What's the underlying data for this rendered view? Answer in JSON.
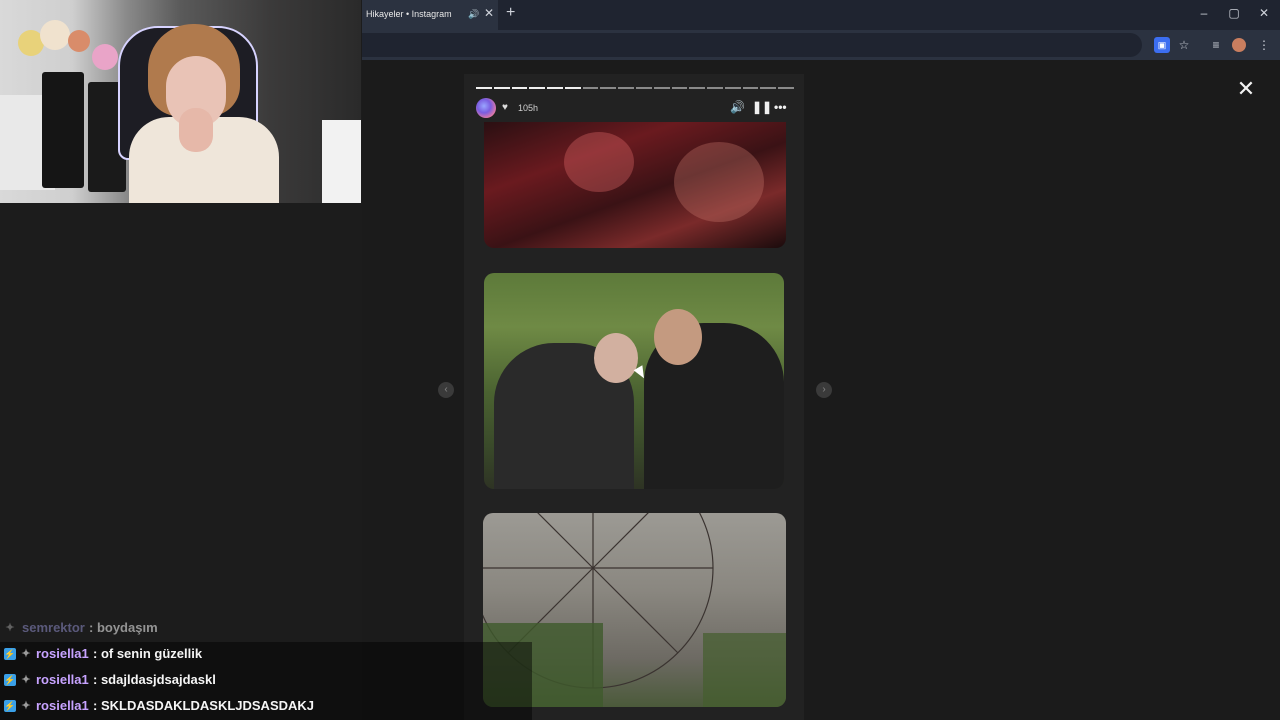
{
  "browser": {
    "tab_title": "Hikayeler • Instagram",
    "tab_audio_icon": "speaker-icon",
    "tab_close": "✕",
    "new_tab": "+",
    "window_controls": [
      "–",
      "▢",
      "✕"
    ]
  },
  "toolbar": {
    "icons": [
      "cast-extension-icon",
      "bookmark-star-icon",
      "media-queue-icon",
      "profile-avatar-icon",
      "kebab-menu-icon"
    ]
  },
  "story": {
    "time_ago": "105h",
    "progress_segments": 18,
    "progress_done": 6,
    "controls": [
      "volume-icon",
      "pause-icon",
      "more-icon"
    ]
  },
  "page": {
    "close_label": "✕",
    "prev_arrow": "‹",
    "next_arrow": "›"
  },
  "chat": {
    "messages": [
      {
        "user": "semrektor",
        "text": ": boydaşım",
        "user_color": "#8e8cc9",
        "faded": true
      },
      {
        "user": "rosiella1",
        "text": ": of senin güzellik",
        "user_color": "#c7a3ff",
        "faded": false
      },
      {
        "user": "rosiella1",
        "text": ": sdajldasjdsajdaskl",
        "user_color": "#c7a3ff",
        "faded": false
      },
      {
        "user": "rosiella1",
        "text": ": SKLDASDAKLDASKLJDSASDAKJ",
        "user_color": "#c7a3ff",
        "faded": false
      }
    ]
  },
  "colors": {
    "chrome_dark": "#1f2430",
    "chrome_mid": "#2b3240",
    "page_bg": "#1b1b1b",
    "panel_bg": "#222222",
    "sub_badge": "#3aa0e8"
  }
}
